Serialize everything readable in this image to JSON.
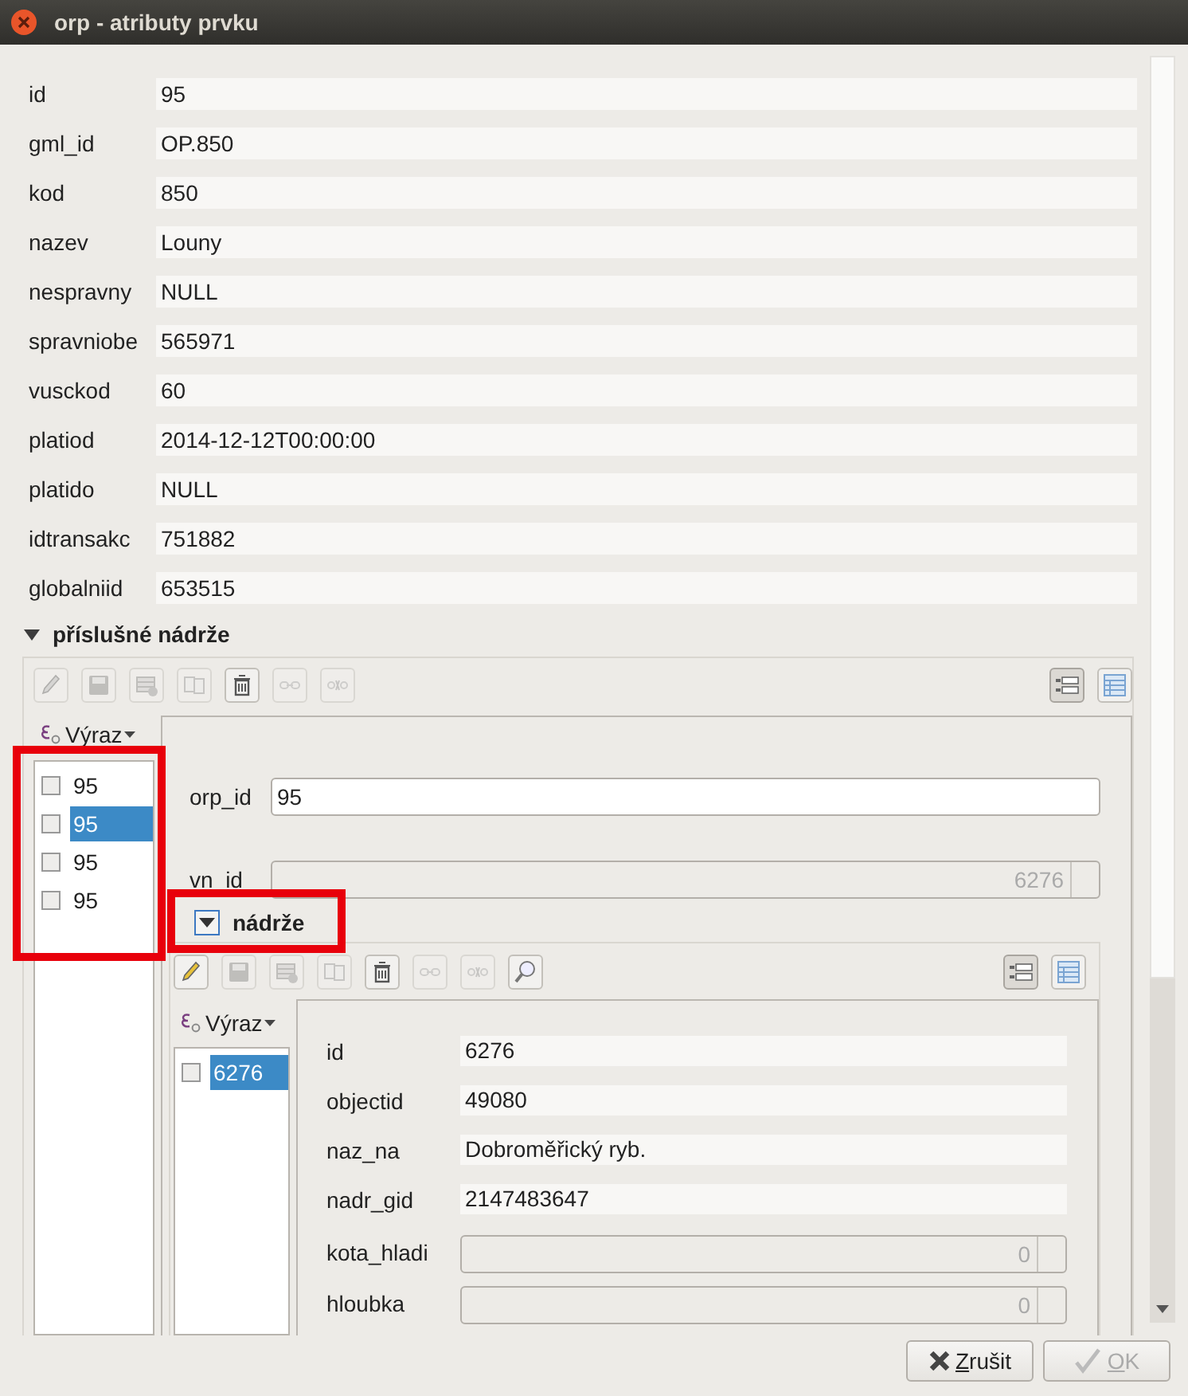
{
  "window": {
    "title": "orp - atributy prvku"
  },
  "attributes": [
    {
      "label": "id",
      "value": "95"
    },
    {
      "label": "gml_id",
      "value": "OP.850"
    },
    {
      "label": "kod",
      "value": "850"
    },
    {
      "label": "nazev",
      "value": "Louny"
    },
    {
      "label": "nespravny",
      "value": "NULL"
    },
    {
      "label": "spravniobe",
      "value": "565971"
    },
    {
      "label": "vusckod",
      "value": "60"
    },
    {
      "label": "platiod",
      "value": "2014-12-12T00:00:00"
    },
    {
      "label": "platido",
      "value": "NULL"
    },
    {
      "label": "idtransakc",
      "value": "751882"
    },
    {
      "label": "globalniid",
      "value": "653515"
    }
  ],
  "relation": {
    "title": "příslušné nádrže",
    "toolbar": [
      {
        "kind": "edit",
        "disabled": true
      },
      {
        "kind": "save",
        "disabled": true
      },
      {
        "kind": "add",
        "disabled": true
      },
      {
        "kind": "duplicate",
        "disabled": true
      },
      {
        "kind": "delete",
        "disabled": false
      },
      {
        "kind": "link",
        "disabled": true
      },
      {
        "kind": "unlink",
        "disabled": true
      }
    ],
    "view_buttons": [
      {
        "kind": "form",
        "selected": true
      },
      {
        "kind": "table",
        "selected": false
      }
    ],
    "list_header": "Výraz",
    "items": [
      {
        "label": "95",
        "checked": false,
        "selected": false
      },
      {
        "label": "95",
        "checked": false,
        "selected": true
      },
      {
        "label": "95",
        "checked": false,
        "selected": false
      },
      {
        "label": "95",
        "checked": false,
        "selected": false
      }
    ],
    "fields": [
      {
        "kind": "text",
        "label": "orp_id",
        "value": "95"
      },
      {
        "kind": "spin",
        "label": "vn_id",
        "value": "6276",
        "disabled": true
      }
    ],
    "child": {
      "title": "nádrže",
      "toolbar": [
        {
          "kind": "edit",
          "disabled": false
        },
        {
          "kind": "save",
          "disabled": true
        },
        {
          "kind": "add",
          "disabled": true
        },
        {
          "kind": "duplicate",
          "disabled": true
        },
        {
          "kind": "delete",
          "disabled": false
        },
        {
          "kind": "link",
          "disabled": true
        },
        {
          "kind": "unlink",
          "disabled": true
        },
        {
          "kind": "zoom",
          "disabled": false
        }
      ],
      "view_buttons": [
        {
          "kind": "form",
          "selected": true
        },
        {
          "kind": "table",
          "selected": false
        }
      ],
      "list_header": "Výraz",
      "items": [
        {
          "label": "6276",
          "checked": false,
          "selected": true
        }
      ],
      "fields": [
        {
          "kind": "readonly",
          "label": "id",
          "value": "6276"
        },
        {
          "kind": "readonly",
          "label": "objectid",
          "value": "49080"
        },
        {
          "kind": "readonly",
          "label": "naz_na",
          "value": "Dobroměřický ryb."
        },
        {
          "kind": "readonly",
          "label": "nadr_gid",
          "value": "2147483647"
        },
        {
          "kind": "spin",
          "label": "kota_hladi",
          "value": "0",
          "disabled": true
        },
        {
          "kind": "spin",
          "label": "hloubka",
          "value": "0",
          "disabled": true
        }
      ]
    }
  },
  "buttons": [
    {
      "kind": "cancel",
      "label": "Zrušit",
      "disabled": false
    },
    {
      "kind": "ok",
      "label": "OK",
      "disabled": true
    }
  ]
}
